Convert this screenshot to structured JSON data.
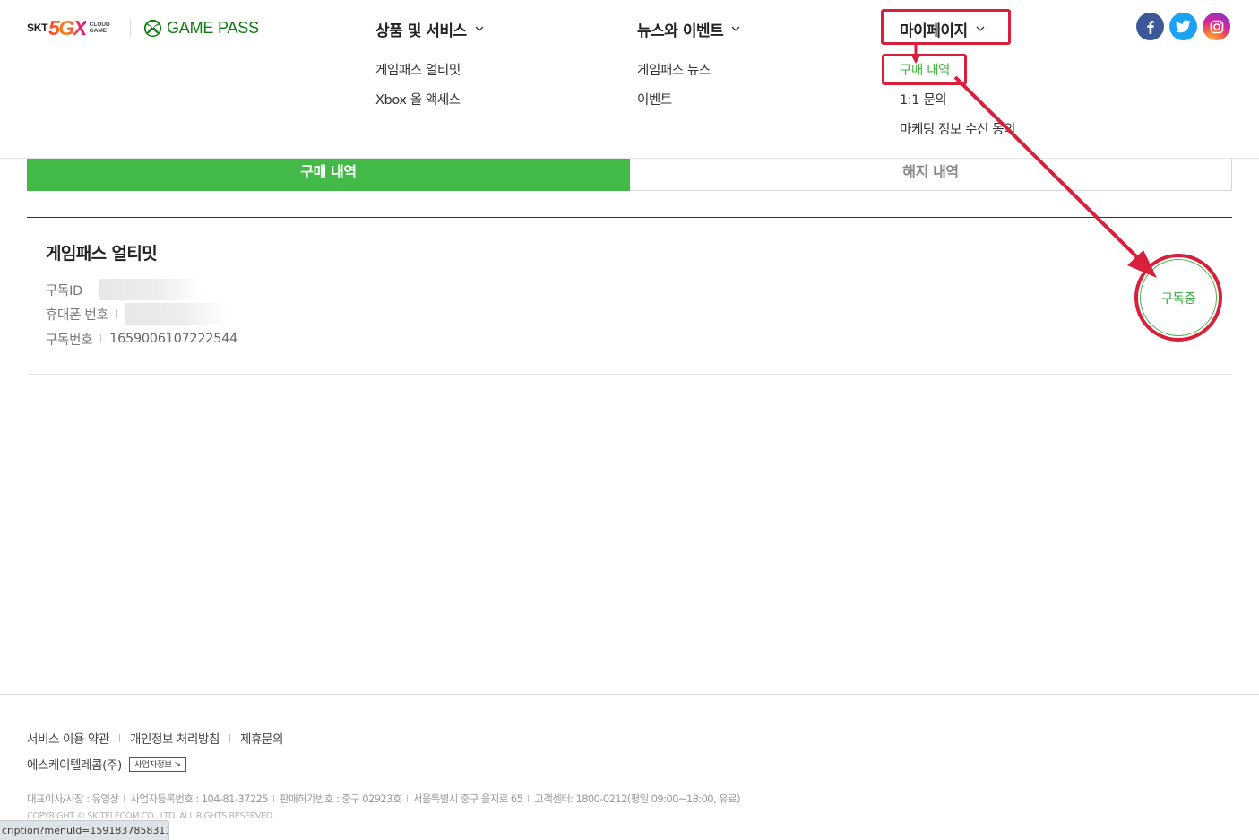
{
  "header": {
    "logo": {
      "skt": "SKT",
      "fivegx": "5GX",
      "cloud_line1": "CLOUD",
      "cloud_line2": "GAME"
    },
    "gamepass_logo": "GAME PASS",
    "nav": [
      {
        "label": "상품 및 서비스",
        "items": [
          "게임패스 얼티밋",
          "Xbox 올 액세스"
        ]
      },
      {
        "label": "뉴스와 이벤트",
        "items": [
          "게임패스 뉴스",
          "이벤트"
        ]
      },
      {
        "label": "마이페이지",
        "items": [
          "구매 내역",
          "1:1 문의",
          "마케팅 정보 수신 동의"
        ],
        "active_item": "구매 내역"
      }
    ],
    "social_icons": [
      "facebook-icon",
      "twitter-icon",
      "instagram-icon"
    ]
  },
  "tabs": {
    "active": "구매 내역",
    "inactive": "해지 내역"
  },
  "purchase": {
    "product": "게임패스 얼티밋",
    "rows": [
      {
        "label": "구독ID",
        "value": ""
      },
      {
        "label": "휴대폰 번호",
        "value": ""
      },
      {
        "label": "구독번호",
        "value": "1659006107222544"
      }
    ],
    "status": "구독중"
  },
  "footer": {
    "links": [
      "서비스 이용 약관",
      "개인정보 처리방침",
      "제휴문의"
    ],
    "company": "에스케이텔레콤(주)",
    "biz_info_button": "사업자정보 >",
    "info": [
      "대표이사/사장 : 유영상",
      "사업자등록번호 : 104-81-37225",
      "판매허가번호 : 중구 02923호",
      "서울특별시 중구 을지로 65",
      "고객센터: 1800-0212(평일 09:00~18:00, 유료)"
    ],
    "copyright": "COPYRIGHT © SK TELECOM CO., LTD. ALL RIGHTS RESERVED."
  },
  "status_bar_url": "cription?menuId=1591837858311",
  "colors": {
    "accent_green": "#43b947",
    "annotation_red": "#d81f3c",
    "active_link": "#3db83d"
  }
}
